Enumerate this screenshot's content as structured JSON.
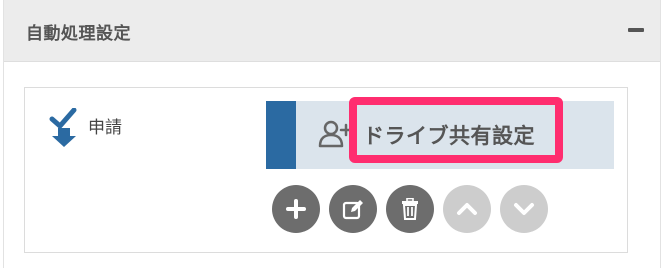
{
  "panel": {
    "title": "自動処理設定",
    "collapse_icon": "minus-icon"
  },
  "step": {
    "label": "申請",
    "icon": "check-arrow-down-icon",
    "icon_color": "#2b6aa2"
  },
  "action": {
    "label": "ドライブ共有設定",
    "icon": "user-plus-icon",
    "accent_color": "#2b6aa2",
    "highlight_color": "#ff2d6f"
  },
  "buttons": [
    {
      "name": "add-button",
      "icon": "plus-icon",
      "enabled": true
    },
    {
      "name": "edit-button",
      "icon": "edit-icon",
      "enabled": true
    },
    {
      "name": "delete-button",
      "icon": "trash-icon",
      "enabled": true
    },
    {
      "name": "move-up-button",
      "icon": "chevron-up-icon",
      "enabled": false
    },
    {
      "name": "move-down-button",
      "icon": "chevron-down-icon",
      "enabled": false
    }
  ]
}
